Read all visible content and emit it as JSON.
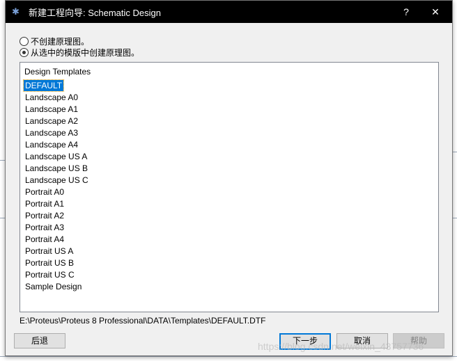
{
  "window": {
    "title": "新建工程向导: Schematic Design",
    "help_label": "?",
    "close_label": "✕",
    "icon": "proteus-icon"
  },
  "options": [
    {
      "label": "不创建原理图。",
      "selected": false
    },
    {
      "label": "从选中的模版中创建原理图。",
      "selected": true
    }
  ],
  "templates": {
    "header": "Design Templates",
    "selected": "DEFAULT",
    "items": [
      "DEFAULT",
      "Landscape A0",
      "Landscape A1",
      "Landscape A2",
      "Landscape A3",
      "Landscape A4",
      "Landscape US A",
      "Landscape US B",
      "Landscape US C",
      "Portrait A0",
      "Portrait A1",
      "Portrait A2",
      "Portrait A3",
      "Portrait A4",
      "Portrait US A",
      "Portrait US B",
      "Portrait US C",
      "Sample Design"
    ]
  },
  "path": "E:\\Proteus\\Proteus 8 Professional\\DATA\\Templates\\DEFAULT.DTF",
  "buttons": {
    "back": "后退",
    "next": "下一步",
    "cancel": "取消",
    "help": "帮助"
  },
  "watermark": "https://blog.csdn.net/weixin_43757736",
  "colors": {
    "selection": "#0078d7",
    "titlebar": "#000000"
  }
}
